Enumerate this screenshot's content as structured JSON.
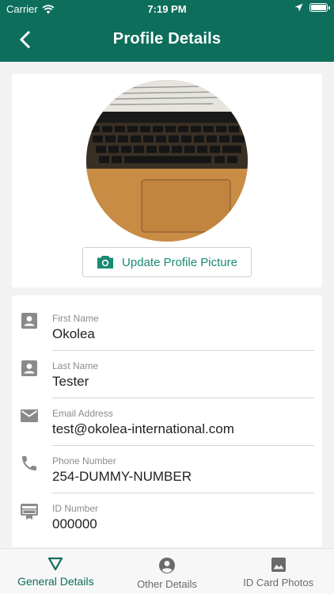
{
  "status_bar": {
    "carrier": "Carrier",
    "time": "7:19 PM"
  },
  "header": {
    "title": "Profile Details",
    "back_icon": "back-arrow-icon"
  },
  "avatar": {
    "update_label": "Update Profile Picture",
    "update_icon": "camera-icon"
  },
  "fields": [
    {
      "label": "First Name",
      "value": "Okolea",
      "icon": "person-card-icon"
    },
    {
      "label": "Last Name",
      "value": "Tester",
      "icon": "person-card-icon"
    },
    {
      "label": "Email Address",
      "value": "test@okolea-international.com",
      "icon": "email-icon"
    },
    {
      "label": "Phone Number",
      "value": "254-DUMMY-NUMBER",
      "icon": "phone-icon"
    },
    {
      "label": "ID Number",
      "value": "000000",
      "icon": "id-card-icon"
    }
  ],
  "bottom_nav": [
    {
      "label": "General Details",
      "icon": "triangle-icon",
      "active": true
    },
    {
      "label": "Other Details",
      "icon": "account-circle-icon",
      "active": false
    },
    {
      "label": "ID Card Photos",
      "icon": "image-icon",
      "active": false
    }
  ],
  "colors": {
    "primary": "#0d6e5b",
    "accent": "#1a8a73",
    "icon_gray": "#8a8a8a"
  }
}
